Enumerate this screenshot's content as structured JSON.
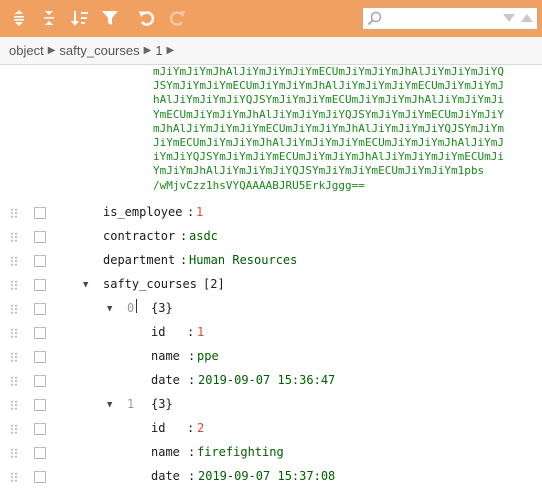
{
  "toolbar": {
    "buttons": [
      "expand-all-icon",
      "collapse-all-icon",
      "sort-icon",
      "filter-icon",
      "undo-icon",
      "redo-icon"
    ],
    "accent": "#f0a060"
  },
  "breadcrumb": {
    "root": "object",
    "level1": "safty_courses",
    "level2": "1"
  },
  "base64_lines": [
    "mJiYmJiYmJhAlJiYmJiYmJiYmECUmJiYmJiYmJhAlJiYmJiYmJiYQ",
    "JSYmJiYmJiYmECUmJiYmJiYmJhAlJiYmJiYmJiYmECUmJiYmJiYmJ",
    "hAlJiYmJiYmJiYQJSYmJiYmJiYmECUmJiYmJiYmJhAlJiYmJiYmJi",
    "YmECUmJiYmJiYmJhAlJiYmJiYmJiYQJSYmJiYmJiYmECUmJiYmJiY",
    "mJhAlJiYmJiYmJiYmECUmJiYmJiYmJhAlJiYmJiYmJiYQJSYmJiYm",
    "JiYmECUmJiYmJiYmJhAlJiYmJiYmJiYmECUmJiYmJiYmJhAlJiYmJ",
    "iYmJiYQJSYmJiYmJiYmECUmJiYmJiYmJhAlJiYmJiYmJiYmECUmJi",
    "YmJiYmJhAlJiYmJiYmJiYQJSYmJiYmJiYmECUmJiYmJiYm1pbs",
    "/wMjvCzz1hsVYQAAAABJRU5ErkJggg=="
  ],
  "fields": {
    "is_employee": {
      "key": "is_employee",
      "value": "1"
    },
    "contractor": {
      "key": "contractor",
      "value": "asdc"
    },
    "department": {
      "key": "department",
      "value": "Human Resources"
    },
    "safty_courses": {
      "key": "safty_courses",
      "count": "[2]"
    }
  },
  "courses": [
    {
      "index": "0",
      "count": "{3}",
      "id_key": "id",
      "id": "1",
      "name_key": "name",
      "name": "ppe",
      "date_key": "date",
      "date": "2019-09-07 15:36:47"
    },
    {
      "index": "1",
      "count": "{3}",
      "id_key": "id",
      "id": "2",
      "name_key": "name",
      "name": "firefighting",
      "date_key": "date",
      "date": "2019-09-07 15:37:08"
    }
  ],
  "colon": ":"
}
